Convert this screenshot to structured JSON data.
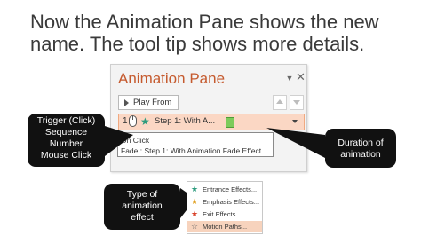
{
  "slide": {
    "title_line1": "Now the Animation Pane shows the new",
    "title_line2": "name. The tool tip shows more details."
  },
  "pane": {
    "title": "Animation Pane",
    "dropdown_glyph": "▼",
    "close_glyph": "✕",
    "play_label": "Play From",
    "row": {
      "sequence": "1",
      "mouse_icon": "mouse-click-icon",
      "star_icon": "entrance-star-icon",
      "label": "Step 1: With A...",
      "duration_color": "#7ccb5b"
    },
    "tooltip": {
      "line1": "On Click",
      "line2": "Fade : Step 1: With Animation Fade Effect"
    }
  },
  "callouts": {
    "trigger": [
      "Trigger (Click)",
      "Sequence",
      "Number",
      "Mouse Click"
    ],
    "duration": [
      "Duration of",
      "animation"
    ],
    "type": [
      "Type of",
      "animation",
      "effect"
    ]
  },
  "effects_menu": {
    "items": [
      {
        "label": "Entrance Effects...",
        "color": "#2e9c7e"
      },
      {
        "label": "Emphasis Effects...",
        "color": "#e0a020"
      },
      {
        "label": "Exit Effects...",
        "color": "#d9432b"
      },
      {
        "label": "Motion Paths...",
        "color": "#666666"
      }
    ]
  }
}
